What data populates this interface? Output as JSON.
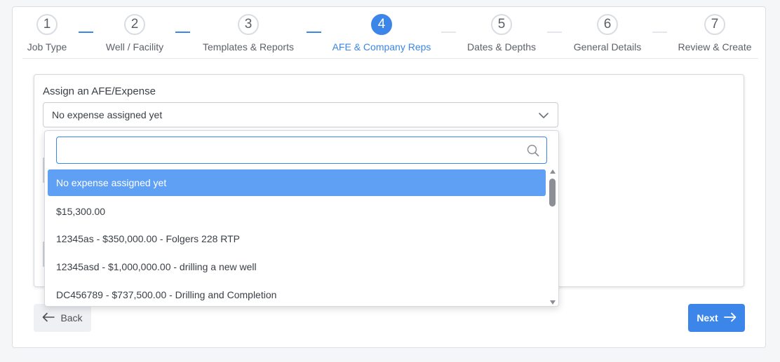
{
  "stepper": {
    "steps": [
      {
        "number": "1",
        "label": "Job Type"
      },
      {
        "number": "2",
        "label": "Well / Facility"
      },
      {
        "number": "3",
        "label": "Templates & Reports"
      },
      {
        "number": "4",
        "label": "AFE & Company Reps"
      },
      {
        "number": "5",
        "label": "Dates & Depths"
      },
      {
        "number": "6",
        "label": "General Details"
      },
      {
        "number": "7",
        "label": "Review & Create"
      }
    ],
    "active_step": 4
  },
  "afe": {
    "title": "Assign an AFE/Expense",
    "selected_value": "No expense assigned yet",
    "search_value": "",
    "search_placeholder": "",
    "options": [
      "No expense assigned yet",
      "$15,300.00",
      "12345as - $350,000.00 - Folgers 228 RTP",
      "12345asd - $1,000,000.00 - drilling a new well",
      "DC456789 - $737,500.00 - Drilling and Completion"
    ],
    "selected_option_index": 0
  },
  "footer": {
    "back_label": "Back",
    "next_label": "Next"
  },
  "colors": {
    "accent": "#3b86e8",
    "selected_option": "#5fa0f5"
  },
  "icons": {
    "select": "chevron-down-icon",
    "search": "search-icon",
    "back": "arrow-left-icon",
    "next": "arrow-right-icon"
  }
}
